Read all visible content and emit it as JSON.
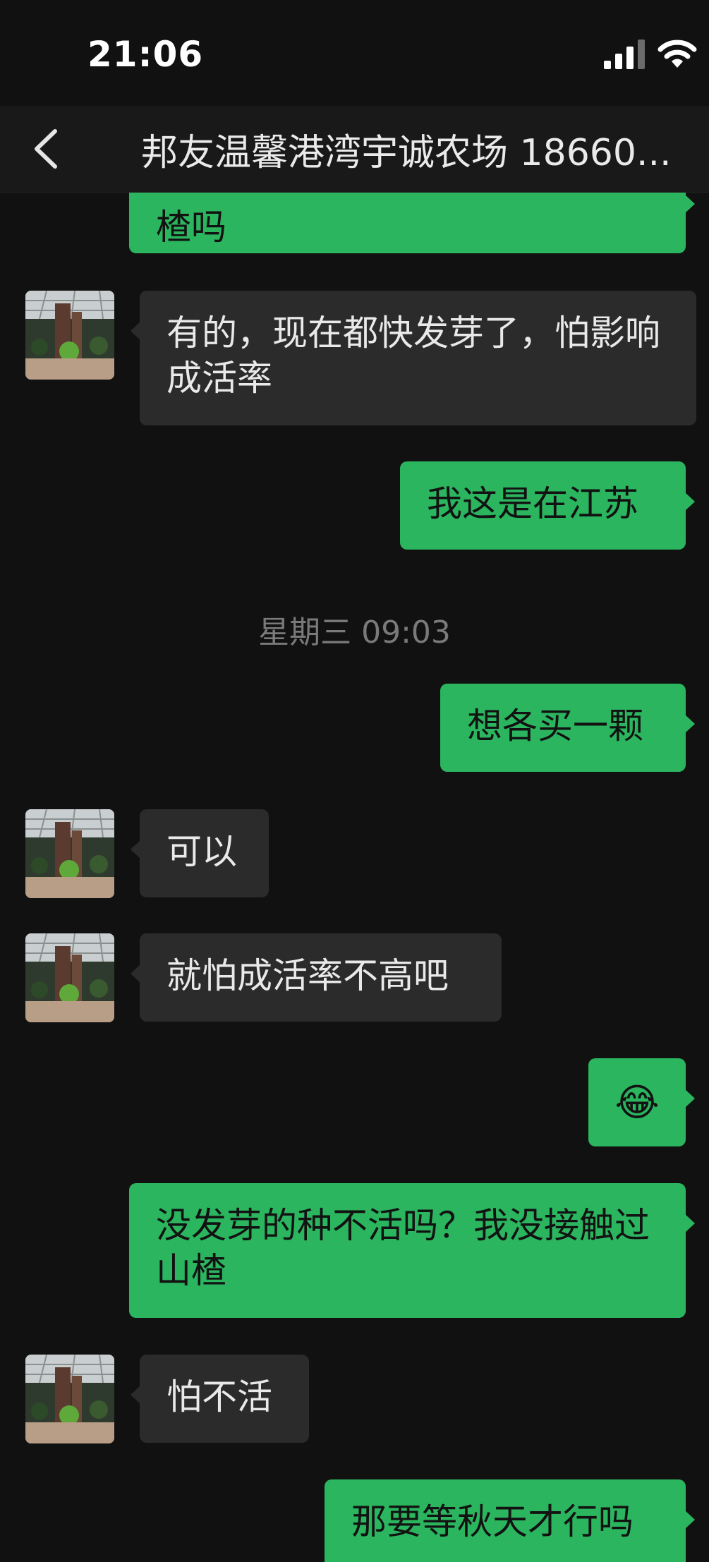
{
  "status": {
    "time": "21:06"
  },
  "header": {
    "title": "邦友温馨港湾宇诚农场 18660..."
  },
  "chat": {
    "messages": [
      {
        "text": "楂吗"
      },
      {
        "text": "有的，现在都快发芽了，怕影响成活率"
      },
      {
        "text": "我这是在江苏"
      },
      {
        "text": "想各买一颗"
      },
      {
        "text": "可以"
      },
      {
        "text": "就怕成活率不高吧"
      },
      {
        "emoji": "😂"
      },
      {
        "text": "没发芽的种不活吗？我没接触过山楂"
      },
      {
        "text": "怕不活"
      },
      {
        "text": "那要等秋天才行吗"
      }
    ],
    "timestamp": "星期三 09:03"
  },
  "colors": {
    "sent_bubble": "#2bb55f",
    "received_bubble": "#2b2b2b",
    "background": "#111111"
  }
}
